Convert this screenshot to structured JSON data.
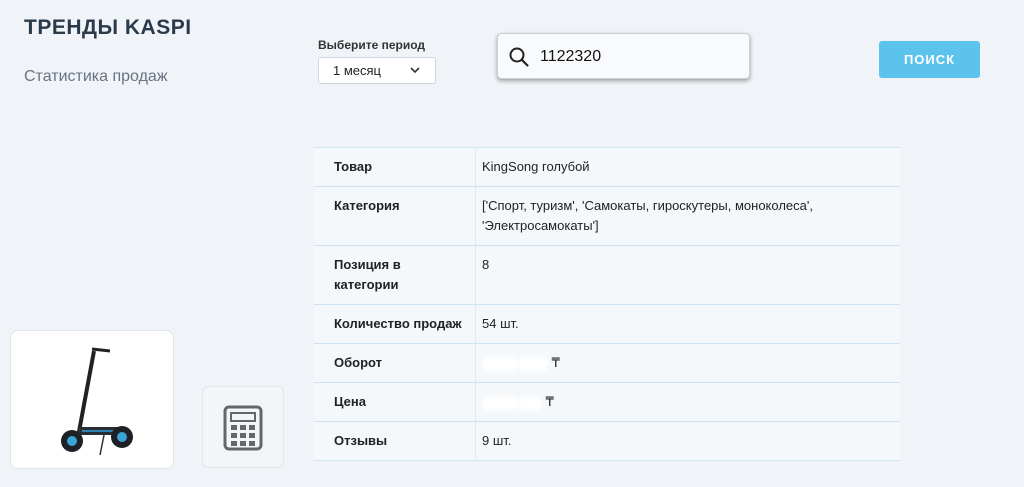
{
  "header": {
    "brand": "ТРЕНДЫ KASPI",
    "subtitle": "Статистика продаж"
  },
  "period": {
    "label": "Выберите период",
    "selected": "1 месяц"
  },
  "search": {
    "value": "1122320",
    "button_label": "ПОИСК"
  },
  "product": {
    "rows": [
      {
        "key": "Товар",
        "value": "KingSong голубой"
      },
      {
        "key": "Категория",
        "value": "['Спорт, туризм', 'Самокаты, гироскутеры, моноколеса', 'Электросамокаты']"
      },
      {
        "key": "Позиция в категории",
        "value": "8"
      },
      {
        "key": "Количество продаж",
        "value": "54 шт."
      },
      {
        "key": "Оборот",
        "value": "₸"
      },
      {
        "key": "Цена",
        "value": "₸"
      },
      {
        "key": "Отзывы",
        "value": "9 шт."
      }
    ]
  },
  "icons": {
    "search": "search-icon",
    "dropdown": "chevron-down-icon",
    "calculator": "calculator-icon",
    "product_image": "scooter-image"
  },
  "colors": {
    "accent": "#5bc3ec",
    "background": "#f0f4f8"
  }
}
